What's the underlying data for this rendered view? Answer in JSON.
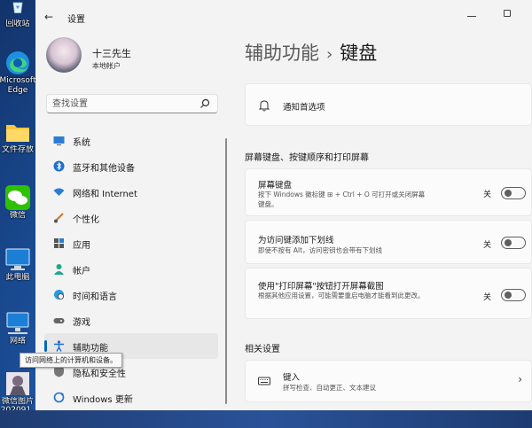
{
  "desktop": {
    "icons": [
      {
        "label": "回收站",
        "icon": "recycle-bin-icon"
      },
      {
        "label": "Microsoft Edge",
        "icon": "edge-icon"
      },
      {
        "label": "文件存放",
        "icon": "folder-icon"
      },
      {
        "label": "微信",
        "icon": "wechat-icon"
      },
      {
        "label": "此电脑",
        "icon": "computer-icon"
      },
      {
        "label": "网络",
        "icon": "network-icon"
      },
      {
        "label": "微信图片_202091...",
        "icon": "image-file-icon"
      }
    ],
    "tooltip": "访问网络上的计算机和设备。"
  },
  "window": {
    "title": "设置",
    "profile": {
      "name": "十三先生",
      "account": "本地帐户"
    },
    "search": {
      "placeholder": "查找设置"
    },
    "nav": [
      {
        "label": "系统",
        "icon": "monitor-icon"
      },
      {
        "label": "蓝牙和其他设备",
        "icon": "bluetooth-icon"
      },
      {
        "label": "网络和 Internet",
        "icon": "wifi-icon"
      },
      {
        "label": "个性化",
        "icon": "brush-icon"
      },
      {
        "label": "应用",
        "icon": "apps-icon"
      },
      {
        "label": "帐户",
        "icon": "person-icon"
      },
      {
        "label": "时间和语言",
        "icon": "globe-clock-icon"
      },
      {
        "label": "游戏",
        "icon": "gamepad-icon"
      },
      {
        "label": "辅助功能",
        "icon": "accessibility-icon",
        "active": true
      },
      {
        "label": "隐私和安全性",
        "icon": "shield-icon"
      },
      {
        "label": "Windows 更新",
        "icon": "update-icon"
      }
    ],
    "breadcrumb": {
      "parent": "辅助功能",
      "separator": "›",
      "current": "键盘"
    },
    "notification_card": {
      "title": "通知首选项",
      "icon": "bell-icon"
    },
    "section1_title": "屏幕键盘、按键顺序和打印屏幕",
    "settings": [
      {
        "title": "屏幕键盘",
        "desc": "按下 Windows 徽标键 ⊞ + Ctrl + O 可打开或关闭屏幕键盘。",
        "state": "关"
      },
      {
        "title": "为访问键添加下划线",
        "desc": "即使不按有 Alt，访问密钥也会带有下划线",
        "state": "关"
      },
      {
        "title": "使用\"打印屏幕\"按钮打开屏幕截图",
        "desc": "根据其他应用设置，可能需要重启电脑才能看到此更改。",
        "state": "关"
      }
    ],
    "section2_title": "相关设置",
    "related": [
      {
        "title": "键入",
        "desc": "拼写检查、自动更正、文本建议",
        "icon": "keyboard-icon"
      }
    ]
  }
}
